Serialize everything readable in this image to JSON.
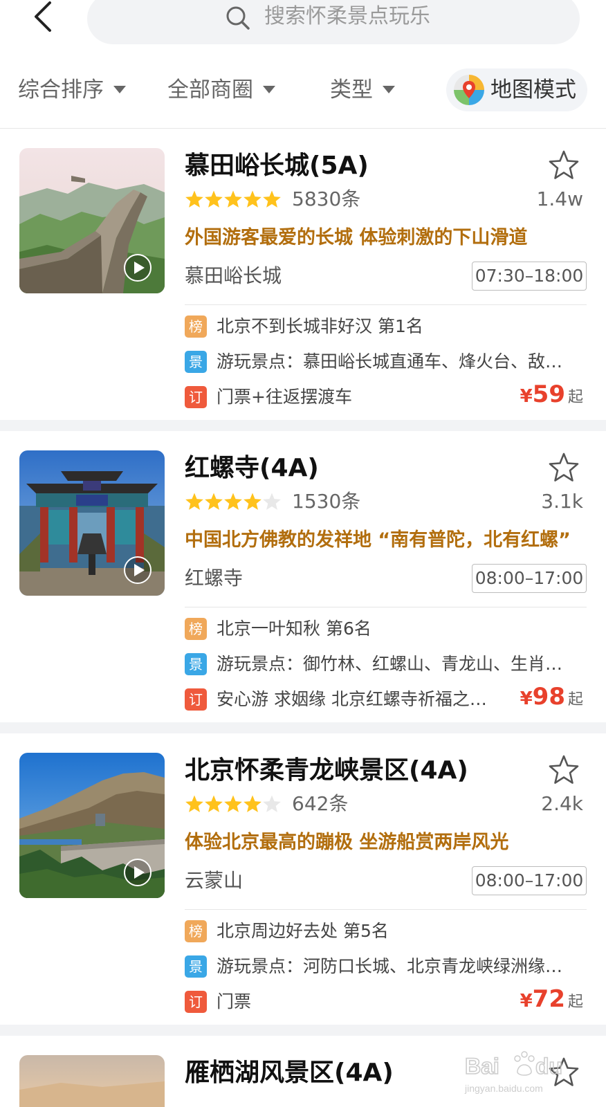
{
  "header": {
    "back_icon": "chevron-left-icon",
    "search_placeholder": "搜索怀柔景点玩乐",
    "search_icon": "search-icon"
  },
  "filters": {
    "sort": "综合排序",
    "area": "全部商圈",
    "type": "类型",
    "map_mode": "地图模式"
  },
  "colors": {
    "tagline": "#b26e0e",
    "price": "#e8412c",
    "star": "#ffc21c",
    "badge_rank": "#f0a85a",
    "badge_scenic": "#3aa7e6",
    "badge_order": "#ef5a3c"
  },
  "listings": [
    {
      "title": "慕田峪长城(5A)",
      "rating": 5,
      "reviews": "5830条",
      "popularity": "1.4w",
      "tagline": "外国游客最爱的长城  体验刺激的下山滑道",
      "location": "慕田峪长城",
      "hours": "07:30–18:00",
      "rank_badge": "榜",
      "rank_text": "北京不到长城非好汉 第1名",
      "scenic_badge": "景",
      "scenic_text": "游玩景点：慕田峪长城直通车、烽火台、敌…",
      "order_badge": "订",
      "order_text": "门票+往返摆渡车",
      "price_symbol": "¥",
      "price": "59",
      "price_suffix": "起"
    },
    {
      "title": "红螺寺(4A)",
      "rating": 4,
      "reviews": "1530条",
      "popularity": "3.1k",
      "tagline": "中国北方佛教的发祥地 “南有普陀，北有红螺”",
      "location": "红螺寺",
      "hours": "08:00–17:00",
      "rank_badge": "榜",
      "rank_text": "北京一叶知秋 第6名",
      "scenic_badge": "景",
      "scenic_text": "游玩景点：御竹林、红螺山、青龙山、生肖…",
      "order_badge": "订",
      "order_text": "安心游 求姻缘 北京红螺寺祈福之…",
      "price_symbol": "¥",
      "price": "98",
      "price_suffix": "起"
    },
    {
      "title": "北京怀柔青龙峡景区(4A)",
      "rating": 4,
      "reviews": "642条",
      "popularity": "2.4k",
      "tagline": "体验北京最高的蹦极  坐游船赏两岸风光",
      "location": "云蒙山",
      "hours": "08:00–17:00",
      "rank_badge": "榜",
      "rank_text": "北京周边好去处 第5名",
      "scenic_badge": "景",
      "scenic_text": "游玩景点：河防口长城、北京青龙峡绿洲缘…",
      "order_badge": "订",
      "order_text": "门票",
      "price_symbol": "¥",
      "price": "72",
      "price_suffix": "起"
    },
    {
      "title": "雁栖湖风景区(4A)"
    }
  ],
  "watermark": {
    "brand": "Baidu经验",
    "url": "jingyan.baidu.com"
  }
}
